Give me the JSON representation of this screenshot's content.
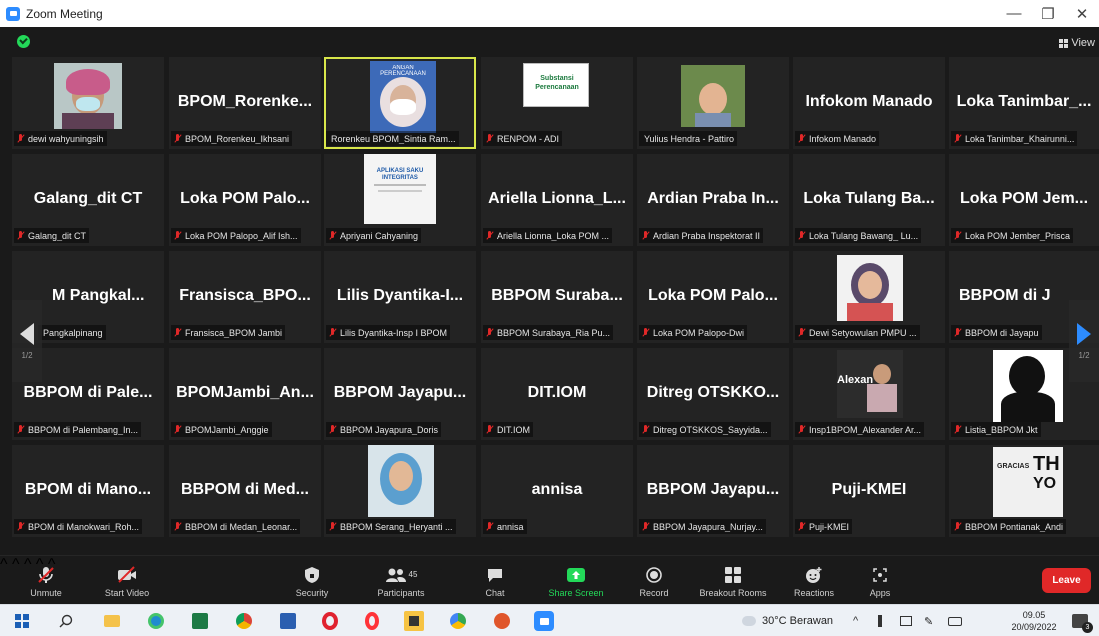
{
  "window": {
    "title": "Zoom Meeting"
  },
  "view_button": {
    "label": "View"
  },
  "pager": {
    "left_page": "1/2",
    "right_page": "1/2"
  },
  "tiles": [
    {
      "caption": "dewi wahyuningsih",
      "big": ""
    },
    {
      "caption": "BPOM_Rorenkeu_Ikhsani",
      "big": "BPOM_Rorenke..."
    },
    {
      "caption": "Rorenkeu BPOM_Sintia Ram...",
      "big": ""
    },
    {
      "caption": "RENPOM - ADI",
      "big": ""
    },
    {
      "caption": "Yulius Hendra - Pattiro",
      "big": ""
    },
    {
      "caption": "Infokom Manado",
      "big": "Infokom Manado"
    },
    {
      "caption": "Loka Tanimbar_Khairunni...",
      "big": "Loka Tanimbar_..."
    },
    {
      "caption": "Galang_dit CT",
      "big": "Galang_dit CT"
    },
    {
      "caption": "Loka POM Palopo_Alif Ish...",
      "big": "Loka POM Palo..."
    },
    {
      "caption": "Apriyani Cahyaning",
      "big": ""
    },
    {
      "caption": "Ariella Lionna_Loka POM ...",
      "big": "Ariella Lionna_L..."
    },
    {
      "caption": "Ardian Praba Inspektorat II",
      "big": "Ardian Praba In..."
    },
    {
      "caption": "Loka Tulang Bawang_ Lu...",
      "big": "Loka Tulang Ba..."
    },
    {
      "caption": "Loka POM Jember_Prisca",
      "big": "Loka POM Jem..."
    },
    {
      "caption": "Pangkalpinang",
      "big": "M Pangkal..."
    },
    {
      "caption": "Fransisca_BPOM Jambi",
      "big": "Fransisca_BPO..."
    },
    {
      "caption": "Lilis Dyantika-Insp I BPOM",
      "big": "Lilis Dyantika-I..."
    },
    {
      "caption": "BBPOM Surabaya_Ria Pu...",
      "big": "BBPOM Suraba..."
    },
    {
      "caption": "Loka POM Palopo-Dwi",
      "big": "Loka POM Palo..."
    },
    {
      "caption": "Dewi Setyowulan PMPU ...",
      "big": ""
    },
    {
      "caption": "BBPOM di Jayapu",
      "big": "BBPOM di J"
    },
    {
      "caption": "BBPOM di Palembang_In...",
      "big": "BBPOM di Pale..."
    },
    {
      "caption": "BPOMJambi_Anggie",
      "big": "BPOMJambi_An..."
    },
    {
      "caption": "BBPOM Jayapura_Doris",
      "big": "BBPOM Jayapu..."
    },
    {
      "caption": "DIT.IOM",
      "big": "DIT.IOM"
    },
    {
      "caption": "Ditreg OTSKKOS_Sayyida...",
      "big": "Ditreg OTSKKO..."
    },
    {
      "caption": "Insp1BPOM_Alexander Ar...",
      "big": "Alexan"
    },
    {
      "caption": "Listia_BBPOM Jkt",
      "big": ""
    },
    {
      "caption": "BPOM di Manokwari_Roh...",
      "big": "BPOM di Mano..."
    },
    {
      "caption": "BBPOM di Medan_Leonar...",
      "big": "BBPOM di Med..."
    },
    {
      "caption": "BBPOM Serang_Heryanti ...",
      "big": ""
    },
    {
      "caption": "annisa",
      "big": "annisa"
    },
    {
      "caption": "BBPOM Jayapura_Nurjay...",
      "big": "BBPOM Jayapu..."
    },
    {
      "caption": "Puji-KMEI",
      "big": "Puji-KMEI"
    },
    {
      "caption": "BBPOM Pontianak_Andi",
      "big": ""
    }
  ],
  "tile_texts": {
    "renpom_slide_title": "Substansi Perencanaan",
    "rorenkeu_banner": "ANGAN PERENCANAAN",
    "apriyani_slide": "APLIKASI SAKU INTEGRITAS",
    "pontianak_word1": "GRACIAS",
    "pontianak_word2": "TH",
    "pontianak_word3": "YO"
  },
  "toolbar": {
    "unmute": "Unmute",
    "start_video": "Start Video",
    "security": "Security",
    "participants": "Participants",
    "participants_count": "45",
    "chat": "Chat",
    "share_screen": "Share Screen",
    "record": "Record",
    "breakout_rooms": "Breakout Rooms",
    "reactions": "Reactions",
    "apps": "Apps",
    "leave": "Leave"
  },
  "taskbar": {
    "weather": "30°C Berawan",
    "time": "09.05",
    "date": "20/09/2022",
    "notifications": "3"
  },
  "colors": {
    "active_speaker_border": "#d8e64a",
    "leave": "#e02828",
    "share_screen": "#23d959",
    "muted_icon": "#e02828"
  }
}
